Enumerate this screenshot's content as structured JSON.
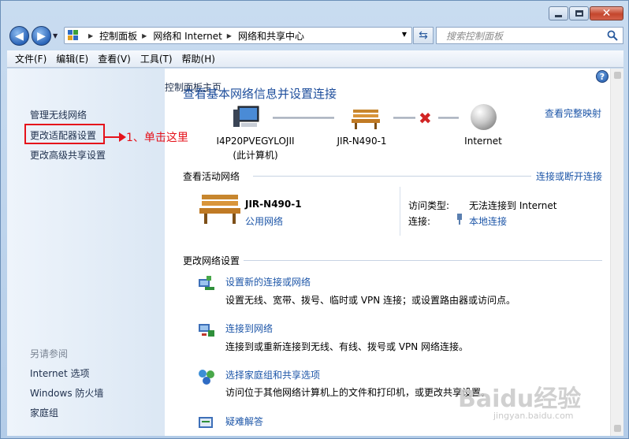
{
  "window": {
    "caption_buttons": [
      "minimize",
      "maximize",
      "close"
    ]
  },
  "address_bar": {
    "crumbs": [
      "控制面板",
      "网络和 Internet",
      "网络和共享中心"
    ],
    "search_placeholder": "搜索控制面板"
  },
  "menu": {
    "items": [
      "文件(F)",
      "编辑(E)",
      "查看(V)",
      "工具(T)",
      "帮助(H)"
    ]
  },
  "left_pane": {
    "home": "控制面板主页",
    "wireless": "管理无线网络",
    "adapter": "更改适配器设置",
    "advanced_sharing": "更改高级共享设置",
    "see_also_header": "另请参阅",
    "internet_options": "Internet 选项",
    "firewall": "Windows 防火墙",
    "homegroup": "家庭组"
  },
  "annotation": {
    "text": "1、单击这里",
    "color": "#e5121b"
  },
  "main": {
    "title": "查看基本网络信息并设置连接",
    "view_full_map": "查看完整映射",
    "nodes": {
      "computer_name": "I4P20PVEGYLOJII",
      "computer_sub": "(此计算机)",
      "router_name": "JIR-N490-1",
      "internet": "Internet"
    },
    "active_networks_label": "查看活动网络",
    "connect_disconnect": "连接或断开连接",
    "active_network": {
      "name": "JIR-N490-1",
      "type": "公用网络",
      "access_type_label": "访问类型:",
      "access_type_value": "无法连接到 Internet",
      "connections_label": "连接:",
      "connections_value": "本地连接"
    },
    "change_settings_label": "更改网络设置",
    "tasks": [
      {
        "link": "设置新的连接或网络",
        "desc": "设置无线、宽带、拨号、临时或 VPN 连接；或设置路由器或访问点。"
      },
      {
        "link": "连接到网络",
        "desc": "连接到或重新连接到无线、有线、拨号或 VPN 网络连接。"
      },
      {
        "link": "选择家庭组和共享选项",
        "desc": "访问位于其他网络计算机上的文件和打印机，或更改共享设置。"
      },
      {
        "link": "疑难解答",
        "desc": ""
      }
    ]
  },
  "watermark": {
    "brand": "Baidu经验",
    "url": "jingyan.baidu.com"
  },
  "colors": {
    "link": "#1d56a8",
    "title": "#1e4e9c",
    "highlight": "#e5121b"
  }
}
